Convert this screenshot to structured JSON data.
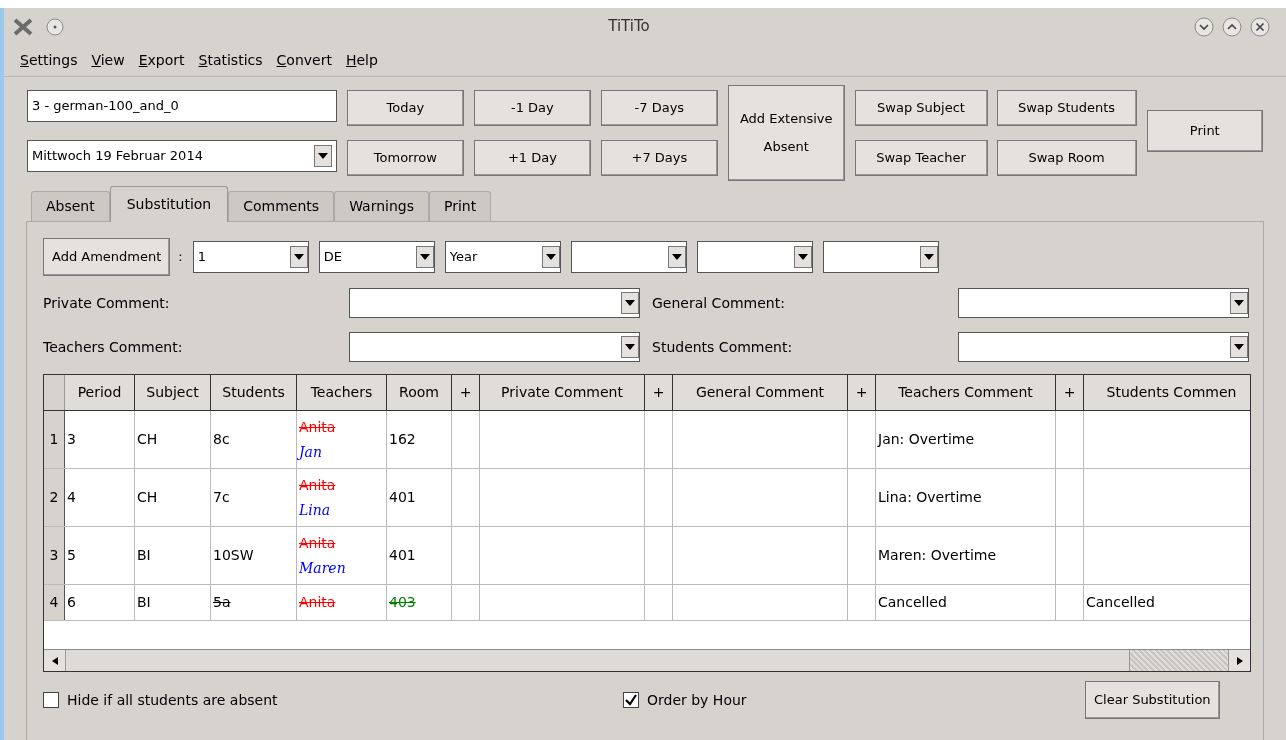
{
  "window": {
    "title": "TiTiTo"
  },
  "menu": [
    {
      "label": "Settings",
      "mnemonic": true
    },
    {
      "label": "View",
      "mnemonic": true
    },
    {
      "label": "Export",
      "mnemonic": true
    },
    {
      "label": "Statistics",
      "mnemonic": true
    },
    {
      "label": "Convert",
      "mnemonic": true
    },
    {
      "label": "Help",
      "mnemonic": true
    }
  ],
  "toolbar": {
    "plan_field": {
      "value": "3 - german-100_and_0"
    },
    "date_combo": {
      "value": "Mittwoch 19 Februar 2014"
    },
    "day_buttons": [
      [
        "Today",
        "Tomorrow"
      ],
      [
        "-1 Day",
        "+1 Day"
      ],
      [
        "-7 Days",
        "+7 Days"
      ]
    ],
    "extensive_button": "Add Extensive Absent",
    "swap_buttons": [
      [
        "Swap Subject",
        "Swap Teacher"
      ],
      [
        "Swap Students",
        "Swap Room"
      ]
    ],
    "print_button": "Print"
  },
  "tabs": [
    {
      "label": "Absent",
      "selected": false
    },
    {
      "label": "Substitution",
      "selected": true
    },
    {
      "label": "Comments",
      "selected": false
    },
    {
      "label": "Warnings",
      "selected": false
    },
    {
      "label": "Print",
      "selected": false
    }
  ],
  "amendment": {
    "button": "Add Amendment",
    "separator": ":",
    "combos": [
      {
        "kind": "filled",
        "value": "1"
      },
      {
        "kind": "filled",
        "value": "DE"
      },
      {
        "kind": "filled",
        "value": "Year"
      },
      {
        "kind": "empty"
      },
      {
        "kind": "empty"
      },
      {
        "kind": "empty"
      }
    ]
  },
  "comment_fields": [
    {
      "label": "Private Comment:"
    },
    {
      "label": "General Comment:"
    },
    {
      "label": "Teachers Comment:"
    },
    {
      "label": "Students Comment:"
    }
  ],
  "table": {
    "columns": [
      "Period",
      "Subject",
      "Students",
      "Teachers",
      "Room",
      "+",
      "Private Comment",
      "+",
      "General Comment",
      "+",
      "Teachers Comment",
      "+",
      "Students Commen"
    ],
    "rows": [
      {
        "number": "1",
        "cells": [
          [
            {
              "text": "3",
              "kind": "plain"
            }
          ],
          [
            {
              "text": "CH",
              "kind": "plain"
            }
          ],
          [
            {
              "text": "8c",
              "kind": "plain"
            }
          ],
          [
            {
              "text": "Anita",
              "kind": "removed"
            },
            {
              "text": "Jan",
              "kind": "added"
            }
          ],
          [
            {
              "text": "162",
              "kind": "plain"
            }
          ],
          [],
          [],
          [],
          [],
          [],
          [
            {
              "text": "Jan: Overtime",
              "kind": "plain"
            }
          ],
          [],
          []
        ]
      },
      {
        "number": "2",
        "cells": [
          [
            {
              "text": "4",
              "kind": "plain"
            }
          ],
          [
            {
              "text": "CH",
              "kind": "plain"
            }
          ],
          [
            {
              "text": "7c",
              "kind": "plain"
            }
          ],
          [
            {
              "text": "Anita",
              "kind": "removed"
            },
            {
              "text": "Lina",
              "kind": "added"
            }
          ],
          [
            {
              "text": "401",
              "kind": "plain"
            }
          ],
          [],
          [],
          [],
          [],
          [],
          [
            {
              "text": "Lina: Overtime",
              "kind": "plain"
            }
          ],
          [],
          []
        ]
      },
      {
        "number": "3",
        "cells": [
          [
            {
              "text": "5",
              "kind": "plain"
            }
          ],
          [
            {
              "text": "BI",
              "kind": "plain"
            }
          ],
          [
            {
              "text": "10SW",
              "kind": "plain"
            }
          ],
          [
            {
              "text": "Anita",
              "kind": "removed"
            },
            {
              "text": "Maren",
              "kind": "added"
            }
          ],
          [
            {
              "text": "401",
              "kind": "plain"
            }
          ],
          [],
          [],
          [],
          [],
          [],
          [
            {
              "text": "Maren: Overtime",
              "kind": "plain"
            }
          ],
          [],
          []
        ]
      },
      {
        "number": "4",
        "cells": [
          [
            {
              "text": "6",
              "kind": "plain"
            }
          ],
          [
            {
              "text": "BI",
              "kind": "plain"
            }
          ],
          [
            {
              "text": "5a",
              "kind": "struck"
            }
          ],
          [
            {
              "text": "Anita",
              "kind": "removed"
            }
          ],
          [
            {
              "text": "403",
              "kind": "freed"
            }
          ],
          [],
          [],
          [],
          [],
          [],
          [
            {
              "text": "Cancelled",
              "kind": "plain"
            }
          ],
          [],
          [
            {
              "text": "Cancelled",
              "kind": "plain"
            }
          ]
        ]
      }
    ]
  },
  "options": [
    {
      "label": "Hide if all students are absent",
      "checked": false
    },
    {
      "label": "Order by Hour",
      "checked": true
    }
  ],
  "clear_button": "Clear Substitution"
}
